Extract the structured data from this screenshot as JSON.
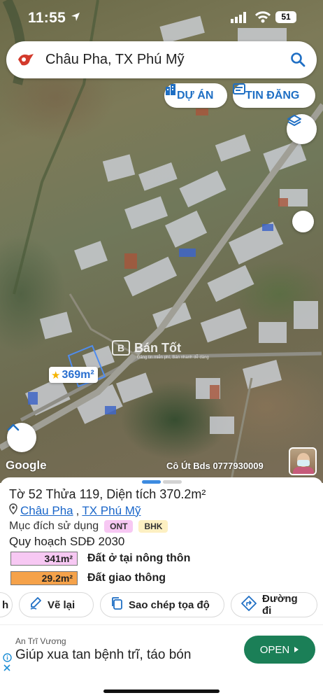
{
  "status_bar": {
    "time": "11:55",
    "battery": "51"
  },
  "search": {
    "query": "Châu Pha, TX Phú Mỹ"
  },
  "map_controls": {
    "du_an_label": "DỰ ÁN",
    "tin_dang_label": "TIN ĐĂNG"
  },
  "map_overlay": {
    "watermark": "Bán Tốt",
    "watermark_sub": "Đăng tin miễn phí, Bán nhanh dễ dàng",
    "area_label": "369m²",
    "google_logo": "Google",
    "agent_name": "Cô Út Bds 0777930009"
  },
  "parcel": {
    "title": "Tờ 52 Thửa 119, Diện tích 370.2m²",
    "commune": "Châu Pha",
    "town": "TX Phú Mỹ",
    "separator": ",",
    "purpose_label": "Mục đích sử dụng",
    "purpose_tags": [
      "ONT",
      "BHK"
    ],
    "plan_title": "Quy hoạch SDĐ 2030",
    "zones": [
      {
        "area": "341m²",
        "label": "Đất ở tại nông thôn",
        "color": "#f7c8f3"
      },
      {
        "area": "29.2m²",
        "label": "Đất giao thông",
        "color": "#f5a24a"
      }
    ]
  },
  "actions": {
    "prev_partial": "h",
    "redraw": "Vẽ lại",
    "copy_coords": "Sao chép tọa độ",
    "directions": "Đường đi"
  },
  "ad": {
    "advertiser": "An Trĩ Vương",
    "headline": "Giúp xua tan bệnh trĩ, táo bón",
    "cta": "OPEN"
  },
  "colors": {
    "accent": "#1f6fc4",
    "ad_button": "#1b7f57"
  }
}
